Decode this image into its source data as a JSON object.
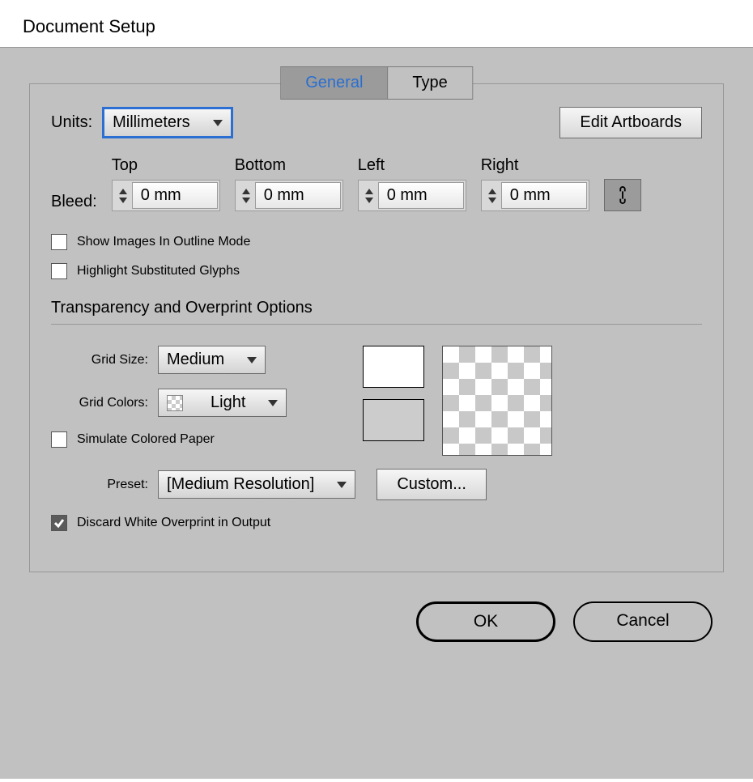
{
  "title": "Document Setup",
  "tabs": {
    "general": "General",
    "type": "Type"
  },
  "units": {
    "label": "Units:",
    "value": "Millimeters"
  },
  "edit_artboards": "Edit Artboards",
  "bleed": {
    "label": "Bleed:",
    "headers": {
      "top": "Top",
      "bottom": "Bottom",
      "left": "Left",
      "right": "Right"
    },
    "values": {
      "top": "0 mm",
      "bottom": "0 mm",
      "left": "0 mm",
      "right": "0 mm"
    },
    "link_icon": "link-icon"
  },
  "checks": {
    "outline": "Show Images In Outline Mode",
    "glyphs": "Highlight Substituted Glyphs",
    "simulate": "Simulate Colored Paper",
    "discard": "Discard White Overprint in Output"
  },
  "section_title": "Transparency and Overprint Options",
  "grid_size": {
    "label": "Grid Size:",
    "value": "Medium"
  },
  "grid_colors": {
    "label": "Grid Colors:",
    "value": "Light"
  },
  "preset": {
    "label": "Preset:",
    "value": "[Medium Resolution]"
  },
  "custom_btn": "Custom...",
  "ok": "OK",
  "cancel": "Cancel"
}
